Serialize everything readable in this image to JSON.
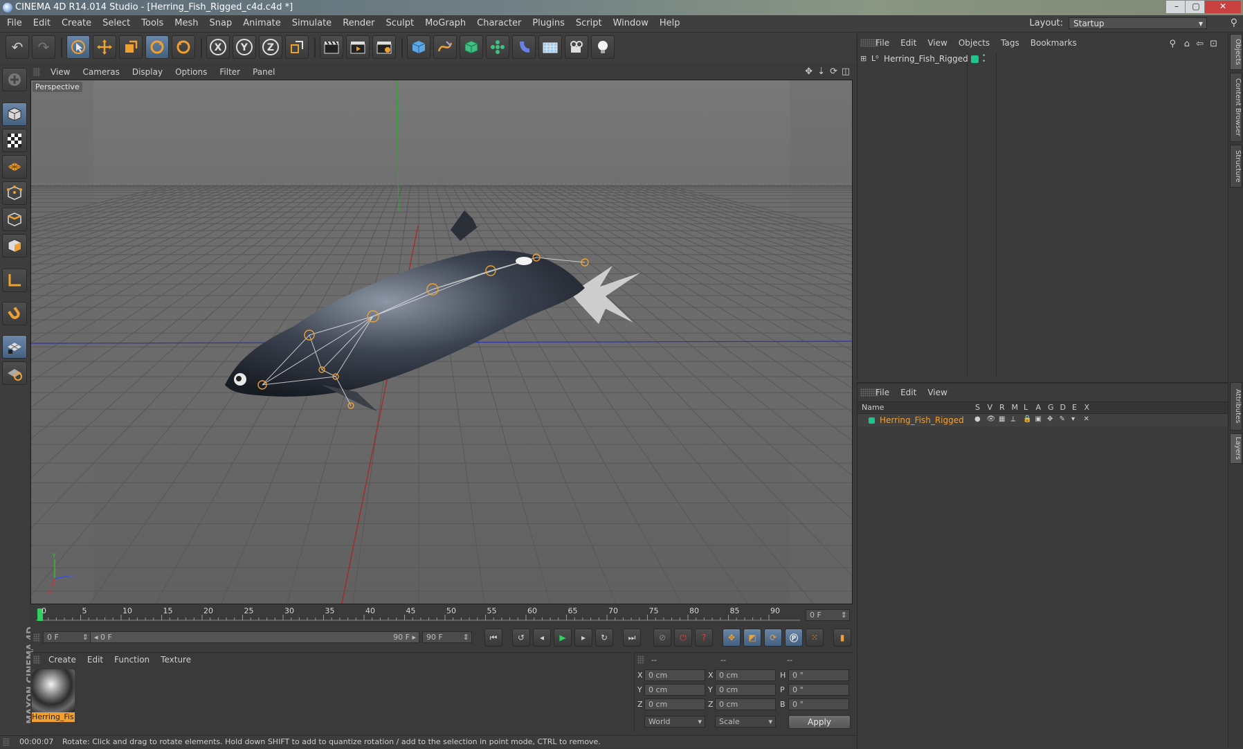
{
  "window": {
    "title": "CINEMA 4D R14.014 Studio - [Herring_Fish_Rigged_c4d.c4d *]",
    "buttons": [
      "–",
      "▢",
      "✕"
    ]
  },
  "menubar": {
    "items": [
      "File",
      "Edit",
      "Create",
      "Select",
      "Tools",
      "Mesh",
      "Snap",
      "Animate",
      "Simulate",
      "Render",
      "Sculpt",
      "MoGraph",
      "Character",
      "Plugins",
      "Script",
      "Window",
      "Help"
    ],
    "layout_label": "Layout:",
    "layout_value": "Startup"
  },
  "viewport": {
    "menu": [
      "View",
      "Cameras",
      "Display",
      "Options",
      "Filter",
      "Panel"
    ],
    "camera_label": "Perspective",
    "axis_labels": {
      "y": "Y",
      "z": "Z",
      "x": "X"
    }
  },
  "timeline": {
    "ticks": [
      "0",
      "5",
      "10",
      "15",
      "20",
      "25",
      "30",
      "35",
      "40",
      "45",
      "50",
      "55",
      "60",
      "65",
      "70",
      "75",
      "80",
      "85",
      "90"
    ],
    "current_frame_field": "0 F"
  },
  "transport": {
    "start_field": "0 F",
    "range_start": "◂ 0 F",
    "range_end": "90 F ▸",
    "end_field": "90 F"
  },
  "material_manager": {
    "menu": [
      "Create",
      "Edit",
      "Function",
      "Texture"
    ],
    "material_name": "Herring_Fis"
  },
  "coordinates": {
    "headers": [
      "--",
      "--",
      "--"
    ],
    "rows": [
      {
        "a": "X",
        "av": "0 cm",
        "b": "X",
        "bv": "0 cm",
        "c": "H",
        "cv": "0 °"
      },
      {
        "a": "Y",
        "av": "0 cm",
        "b": "Y",
        "bv": "0 cm",
        "c": "P",
        "cv": "0 °"
      },
      {
        "a": "Z",
        "av": "0 cm",
        "b": "Z",
        "bv": "0 cm",
        "c": "B",
        "cv": "0 °"
      }
    ],
    "mode_select": "World",
    "scale_select": "Scale",
    "apply_label": "Apply"
  },
  "statusbar": {
    "time": "00:00:07",
    "message": "Rotate: Click and drag to rotate elements. Hold down SHIFT to add to quantize rotation / add to the selection in point mode, CTRL to remove."
  },
  "object_manager": {
    "menu": [
      "File",
      "Edit",
      "View",
      "Objects",
      "Tags",
      "Bookmarks"
    ],
    "object_name": "Herring_Fish_Rigged",
    "layer_color": "#1fc58e"
  },
  "layer_manager": {
    "menu": [
      "File",
      "Edit",
      "View"
    ],
    "name_header": "Name",
    "columns": [
      "S",
      "V",
      "R",
      "M",
      "L",
      "A",
      "G",
      "D",
      "E",
      "X"
    ],
    "layer_name": "Herring_Fish_Rigged"
  },
  "right_tabs": [
    "Objects",
    "Content Browser",
    "Structure",
    "Attributes",
    "Layers"
  ],
  "brand": "MAXON CINEMA 4D",
  "colors": {
    "accent_orange": "#f0a030",
    "accent_blue": "#5a7fa8",
    "layer_green": "#1fc58e"
  }
}
